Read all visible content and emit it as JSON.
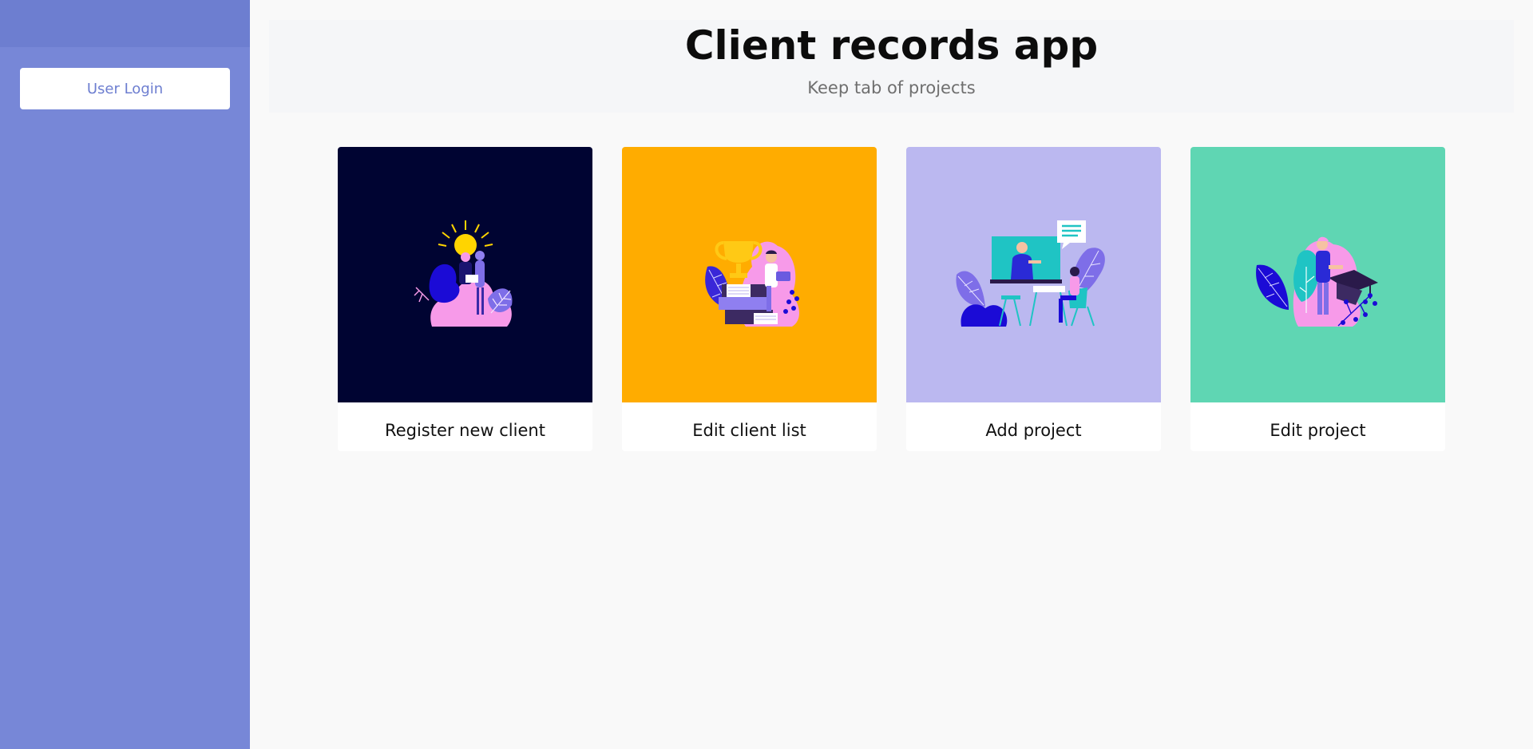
{
  "sidebar": {
    "login_label": "User Login"
  },
  "header": {
    "title": "Client records app",
    "subtitle": "Keep tab of projects"
  },
  "cards": [
    {
      "label": "Register new client",
      "bg": "#000432",
      "icon": "lightbulb-idea-illustration"
    },
    {
      "label": "Edit client list",
      "bg": "#ffac00",
      "icon": "trophy-books-illustration"
    },
    {
      "label": "Add project",
      "bg": "#bbb8f0",
      "icon": "video-meeting-illustration"
    },
    {
      "label": "Edit project",
      "bg": "#5fd6b3",
      "icon": "graduation-cap-illustration"
    }
  ],
  "colors": {
    "sidebar": "#7787d7",
    "accent": "#6d7ed0",
    "pink": "#f79ae9",
    "blue": "#1b0bd6",
    "purple": "#7e6ee8"
  }
}
